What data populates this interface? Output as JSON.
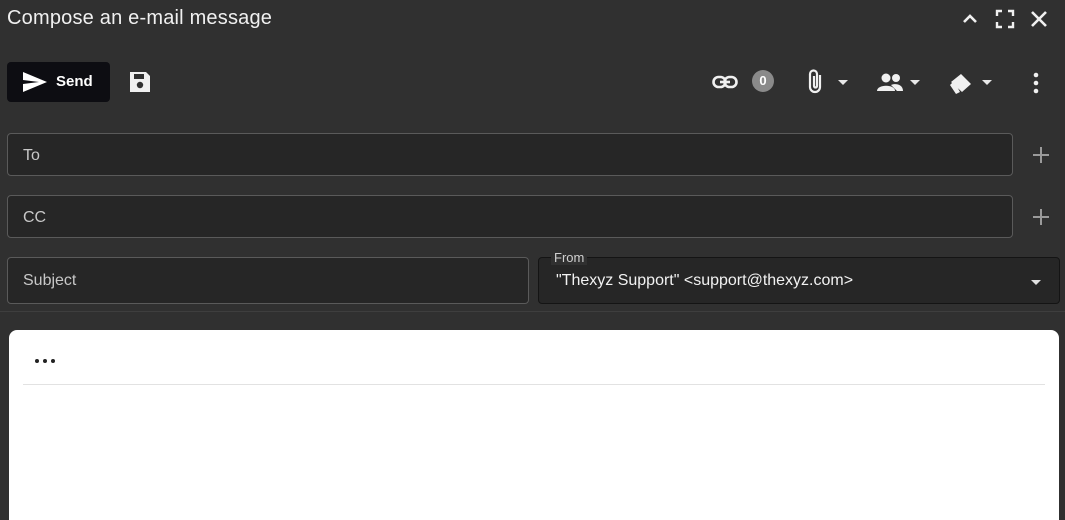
{
  "window": {
    "title": "Compose an e-mail message",
    "controls": [
      "chevron-up-icon",
      "fullscreen-icon",
      "close-icon"
    ]
  },
  "toolbar": {
    "send_label": "Send",
    "link_count": "0"
  },
  "fields": {
    "to_label": "To",
    "cc_label": "CC",
    "subject_label": "Subject",
    "from_label": "From",
    "from_value": "\"Thexyz Support\" <support@thexyz.com>"
  },
  "editor": {
    "more_icon": "more-horizontal-icon"
  },
  "colors": {
    "background": "#303030",
    "field_bg": "#262626",
    "send_bg": "#0d0d12",
    "editor_bg": "#ffffff"
  }
}
